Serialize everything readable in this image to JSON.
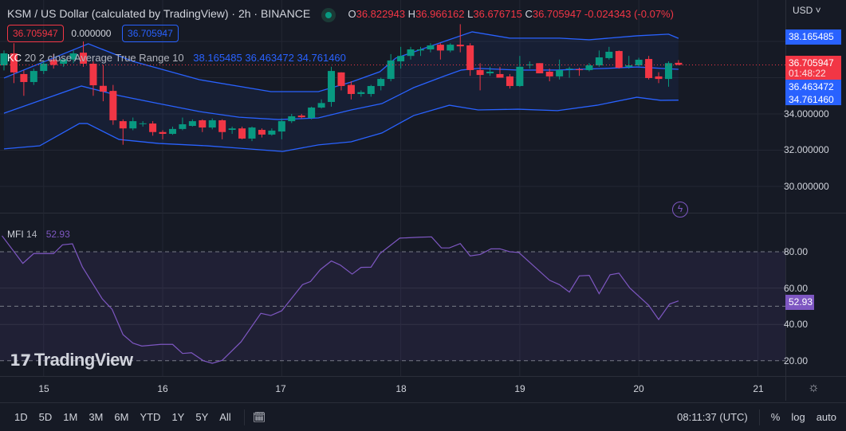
{
  "header": {
    "title": "KSM / US Dollar (calculated by TradingView) · 2h · BINANCE",
    "o_label": "O",
    "o": "36.822943",
    "h_label": "H",
    "h": "36.966162",
    "l_label": "L",
    "l": "36.676715",
    "c_label": "C",
    "c": "36.705947",
    "change": "-0.024343 (-0.07%)",
    "bid": "36.705947",
    "spread": "0.000000",
    "ask": "36.705947"
  },
  "kc": {
    "name": "KC",
    "params": "20 2 close Average True Range 10",
    "upper": "38.165485",
    "middle": "36.463472",
    "lower": "34.761460"
  },
  "mfi": {
    "name": "MFI",
    "params": "14",
    "value": "52.93"
  },
  "price_axis": {
    "currency": "USD",
    "labels": [
      "34.000000",
      "32.000000",
      "30.000000"
    ],
    "tags": {
      "upper": "38.165485",
      "price": "36.705947",
      "countdown": "01:48:22",
      "middle": "36.463472",
      "lower": "34.761460"
    }
  },
  "mfi_axis": {
    "labels": [
      "80.00",
      "60.00",
      "40.00",
      "20.00"
    ],
    "tag": "52.93"
  },
  "time_axis": {
    "labels": [
      "15",
      "16",
      "17",
      "18",
      "19",
      "20",
      "21"
    ]
  },
  "watermark": "TradingView",
  "toolbar": {
    "ranges": [
      "1D",
      "5D",
      "1M",
      "3M",
      "6M",
      "YTD",
      "1Y",
      "5Y",
      "All"
    ],
    "time": "08:11:37 (UTC)",
    "percent": "%",
    "log": "log",
    "auto": "auto"
  },
  "colors": {
    "up": "#089981",
    "down": "#f23645",
    "band": "#2962ff",
    "mfi": "#7e57c2",
    "bg": "#161a25"
  },
  "chart_data": [
    {
      "type": "candlestick",
      "title": "KSM / US Dollar · 2h",
      "ylim": [
        29,
        39.5
      ],
      "day_start_index": {
        "15": 4,
        "16": 16,
        "17": 28,
        "18": 40,
        "19": 52,
        "20": 64,
        "21": 76
      },
      "candles_ohlc": [
        [
          36.68,
          37.5,
          36.4,
          37.34
        ],
        [
          37.34,
          37.9,
          35.7,
          36.29
        ],
        [
          36.2,
          36.4,
          35.0,
          35.76
        ],
        [
          35.76,
          36.5,
          35.6,
          36.37
        ],
        [
          36.37,
          36.9,
          36.2,
          36.77
        ],
        [
          37.0,
          37.3,
          36.5,
          36.7
        ],
        [
          36.77,
          37.1,
          36.6,
          37.0
        ],
        [
          37.0,
          37.5,
          36.8,
          37.34
        ],
        [
          37.38,
          38.0,
          36.6,
          36.77
        ],
        [
          36.77,
          36.9,
          35.0,
          35.58
        ],
        [
          35.55,
          36.7,
          34.7,
          35.23
        ],
        [
          35.27,
          35.6,
          33.4,
          33.65
        ],
        [
          33.6,
          33.7,
          32.3,
          33.2
        ],
        [
          33.2,
          33.8,
          33.1,
          33.6
        ],
        [
          33.47,
          33.6,
          33.3,
          33.48
        ],
        [
          33.47,
          33.6,
          32.8,
          33.0
        ],
        [
          33.0,
          33.1,
          32.6,
          32.9
        ],
        [
          32.9,
          33.3,
          32.85,
          33.17
        ],
        [
          33.17,
          33.8,
          33.1,
          33.43
        ],
        [
          33.34,
          33.7,
          33.3,
          33.6
        ],
        [
          33.65,
          33.7,
          33.0,
          33.25
        ],
        [
          33.25,
          33.75,
          33.15,
          33.65
        ],
        [
          33.65,
          33.7,
          32.6,
          33.0
        ],
        [
          33.12,
          33.3,
          32.9,
          33.2
        ],
        [
          33.2,
          33.3,
          32.6,
          32.64
        ],
        [
          32.64,
          33.3,
          32.5,
          33.25
        ],
        [
          33.12,
          33.2,
          32.7,
          32.86
        ],
        [
          32.86,
          33.2,
          32.8,
          33.08
        ],
        [
          33.03,
          33.75,
          32.6,
          33.6
        ],
        [
          33.6,
          34.0,
          33.5,
          33.87
        ],
        [
          33.91,
          34.0,
          33.75,
          33.82
        ],
        [
          33.78,
          34.4,
          33.7,
          34.35
        ],
        [
          34.35,
          34.8,
          34.3,
          34.6
        ],
        [
          34.66,
          36.6,
          34.4,
          36.37
        ],
        [
          36.29,
          36.3,
          35.3,
          35.54
        ],
        [
          35.6,
          35.8,
          34.8,
          35.1
        ],
        [
          35.1,
          35.3,
          34.95,
          35.2
        ],
        [
          35.1,
          35.6,
          34.95,
          35.54
        ],
        [
          35.54,
          36.0,
          35.3,
          35.93
        ],
        [
          35.93,
          37.3,
          35.8,
          36.95
        ],
        [
          36.9,
          37.7,
          36.5,
          37.2
        ],
        [
          37.2,
          37.7,
          37.0,
          37.56
        ],
        [
          37.5,
          37.7,
          37.2,
          37.56
        ],
        [
          37.56,
          37.9,
          37.4,
          37.78
        ],
        [
          37.82,
          37.9,
          37.0,
          37.5
        ],
        [
          37.5,
          37.9,
          37.4,
          37.82
        ],
        [
          37.82,
          38.95,
          37.4,
          37.73
        ],
        [
          37.78,
          37.9,
          36.1,
          36.42
        ],
        [
          36.42,
          36.8,
          35.3,
          36.15
        ],
        [
          36.24,
          36.6,
          36.1,
          36.33
        ],
        [
          36.2,
          36.6,
          36.0,
          36.0
        ],
        [
          36.07,
          36.2,
          35.4,
          35.54
        ],
        [
          35.54,
          37.2,
          35.5,
          36.6
        ],
        [
          36.68,
          36.9,
          36.5,
          36.73
        ],
        [
          36.8,
          36.8,
          36.24,
          36.24
        ],
        [
          36.33,
          36.5,
          35.8,
          36.07
        ],
        [
          36.07,
          37.0,
          35.9,
          36.42
        ],
        [
          36.46,
          36.6,
          36.0,
          36.5
        ],
        [
          36.46,
          36.55,
          36.1,
          36.44
        ],
        [
          36.42,
          36.8,
          36.35,
          36.68
        ],
        [
          36.68,
          37.5,
          36.6,
          37.12
        ],
        [
          37.08,
          37.7,
          37.0,
          37.43
        ],
        [
          37.47,
          37.5,
          36.5,
          36.55
        ],
        [
          36.6,
          37.2,
          36.5,
          36.68
        ],
        [
          36.68,
          37.1,
          36.6,
          36.99
        ],
        [
          37.03,
          37.2,
          35.9,
          35.98
        ],
        [
          36.07,
          36.3,
          35.7,
          35.93
        ],
        [
          35.93,
          36.9,
          35.5,
          36.8
        ],
        [
          36.82,
          36.97,
          36.68,
          36.71
        ]
      ],
      "kc_upper": [
        [
          0,
          35.98
        ],
        [
          8.5,
          37.87
        ],
        [
          13,
          36.9
        ],
        [
          19.7,
          35.89
        ],
        [
          26.9,
          35.23
        ],
        [
          31.7,
          35.23
        ],
        [
          35,
          35.76
        ],
        [
          37.9,
          36.33
        ],
        [
          39.5,
          37.08
        ],
        [
          47.2,
          38.53
        ],
        [
          51,
          38.18
        ],
        [
          56,
          38.18
        ],
        [
          59,
          38.09
        ],
        [
          63.8,
          38.31
        ],
        [
          67,
          38.4
        ],
        [
          68,
          38.17
        ]
      ],
      "kc_middle": [
        [
          0,
          34.04
        ],
        [
          7.8,
          35.54
        ],
        [
          11.6,
          35.01
        ],
        [
          15.6,
          34.57
        ],
        [
          19.7,
          34.13
        ],
        [
          23.7,
          33.82
        ],
        [
          27.7,
          33.69
        ],
        [
          31.7,
          33.78
        ],
        [
          35,
          34.22
        ],
        [
          38.1,
          34.57
        ],
        [
          41.3,
          35.45
        ],
        [
          44.5,
          36.11
        ],
        [
          46.1,
          36.42
        ],
        [
          47.8,
          36.51
        ],
        [
          51.8,
          36.42
        ],
        [
          55.8,
          36.42
        ],
        [
          60.6,
          36.51
        ],
        [
          63.8,
          36.59
        ],
        [
          68,
          36.46
        ]
      ],
      "kc_lower": [
        [
          0,
          32.07
        ],
        [
          3.6,
          32.24
        ],
        [
          7.6,
          33.47
        ],
        [
          8.4,
          33.47
        ],
        [
          11.6,
          32.59
        ],
        [
          15.6,
          32.37
        ],
        [
          20.5,
          32.24
        ],
        [
          23.7,
          32.11
        ],
        [
          28.1,
          31.93
        ],
        [
          31.7,
          32.29
        ],
        [
          35,
          32.46
        ],
        [
          38.1,
          32.95
        ],
        [
          41.3,
          33.91
        ],
        [
          44.9,
          34.48
        ],
        [
          47.8,
          34.22
        ],
        [
          51.8,
          34.26
        ],
        [
          55.8,
          34.18
        ],
        [
          59.8,
          34.48
        ],
        [
          63.8,
          34.92
        ],
        [
          66.2,
          34.75
        ],
        [
          68,
          34.76
        ]
      ]
    },
    {
      "type": "line",
      "title": "MFI 14",
      "ylim": [
        10,
        95
      ],
      "bands": [
        20,
        80
      ],
      "midline": 50,
      "points": [
        [
          -0.2,
          88.8
        ],
        [
          1.9,
          73.6
        ],
        [
          3,
          79
        ],
        [
          5,
          79
        ],
        [
          5.9,
          83.8
        ],
        [
          6.9,
          84.4
        ],
        [
          7.9,
          71.7
        ],
        [
          9.9,
          54.1
        ],
        [
          10.9,
          48.3
        ],
        [
          12,
          34.4
        ],
        [
          13,
          29.7
        ],
        [
          13.9,
          28.1
        ],
        [
          15.8,
          29
        ],
        [
          17,
          29
        ],
        [
          18,
          24
        ],
        [
          18.9,
          24.4
        ],
        [
          20.1,
          20
        ],
        [
          21,
          18.6
        ],
        [
          22,
          20.2
        ],
        [
          23.9,
          30.4
        ],
        [
          25.9,
          46.1
        ],
        [
          26.9,
          44.9
        ],
        [
          28,
          47.5
        ],
        [
          30.1,
          61.9
        ],
        [
          30.9,
          63.6
        ],
        [
          31.9,
          70.2
        ],
        [
          33,
          74.9
        ],
        [
          33.9,
          72.7
        ],
        [
          35.1,
          67.7
        ],
        [
          36,
          71.4
        ],
        [
          37,
          71.5
        ],
        [
          37.9,
          79
        ],
        [
          39.9,
          87.5
        ],
        [
          41.9,
          88
        ],
        [
          43.1,
          88.2
        ],
        [
          44.1,
          82.1
        ],
        [
          44.9,
          82.1
        ],
        [
          46,
          84.5
        ],
        [
          47,
          77.7
        ],
        [
          48,
          78.5
        ],
        [
          49.1,
          81.6
        ],
        [
          50,
          81.6
        ],
        [
          51,
          80
        ],
        [
          51.9,
          79.6
        ],
        [
          55,
          64.3
        ],
        [
          56,
          61.9
        ],
        [
          57,
          57.8
        ],
        [
          58,
          66.7
        ],
        [
          59,
          67
        ],
        [
          60,
          56.9
        ],
        [
          61.1,
          67.3
        ],
        [
          62,
          68.2
        ],
        [
          63.1,
          60
        ],
        [
          65,
          50.5
        ],
        [
          66,
          42.7
        ],
        [
          67.1,
          51.2
        ],
        [
          68,
          52.93
        ]
      ]
    }
  ]
}
